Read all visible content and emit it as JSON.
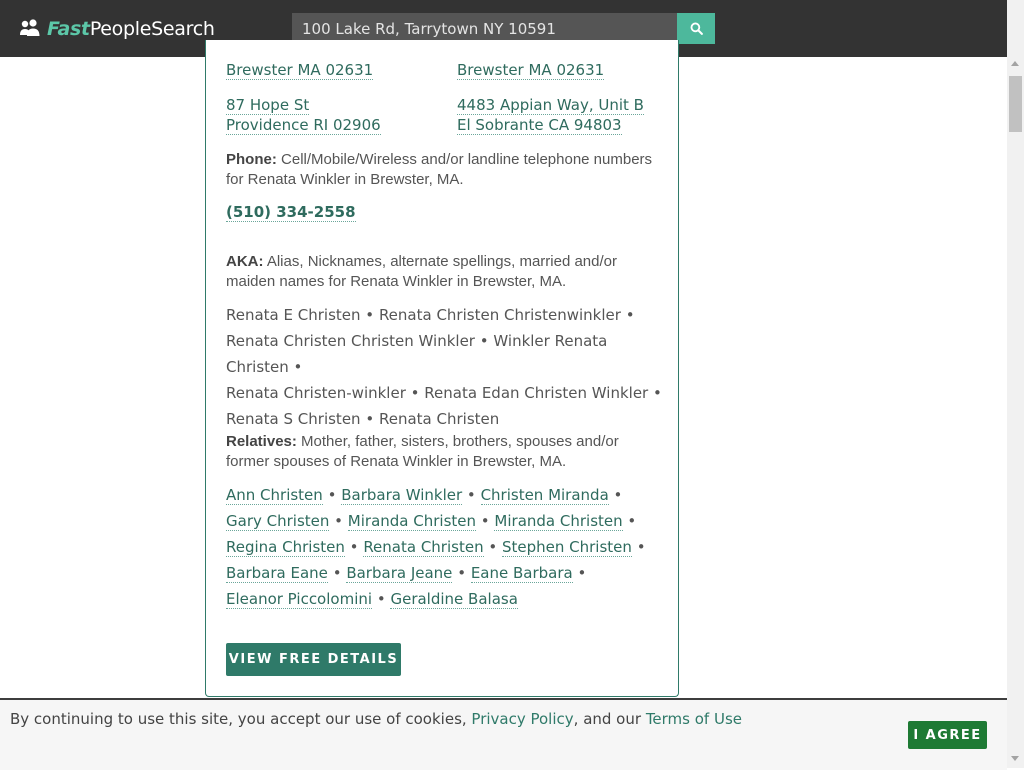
{
  "header": {
    "logo_fast": "Fast",
    "logo_rest": "PeopleSearch",
    "search_value": "100 Lake Rd, Tarrytown NY 10591"
  },
  "addresses": {
    "col1": [
      {
        "line2": "Brewster MA 02631"
      },
      {
        "line1": "87 Hope St",
        "line2": "Providence RI 02906"
      }
    ],
    "col2": [
      {
        "line2": "Brewster MA 02631"
      },
      {
        "line1": "4483 Appian Way, Unit B",
        "line2": "El Sobrante CA 94803"
      }
    ]
  },
  "phone_section": {
    "label": "Phone:",
    "description": "Cell/Mobile/Wireless and/or landline telephone numbers for Renata Winkler in Brewster, MA.",
    "number": "(510) 334-2558"
  },
  "aka_section": {
    "label": "AKA:",
    "description": "Alias, Nicknames, alternate spellings, married and/or maiden names for Renata Winkler in Brewster, MA.",
    "names": [
      "Renata E Christen",
      "Renata Christen Christenwinkler",
      "Renata Christen Christen Winkler",
      "Winkler Renata Christen",
      "Renata Christen-winkler",
      "Renata Edan Christen Winkler",
      "Renata S Christen",
      "Renata Christen"
    ]
  },
  "relatives_section": {
    "label": "Relatives:",
    "description": "Mother, father, sisters, brothers, spouses and/or former spouses of Renata Winkler in Brewster, MA.",
    "names": [
      "Ann Christen",
      "Barbara Winkler",
      "Christen Miranda",
      "Gary Christen",
      "Miranda Christen",
      "Miranda Christen",
      "Regina Christen",
      "Renata Christen",
      "Stephen Christen",
      "Barbara Eane",
      "Barbara Jeane",
      "Eane Barbara",
      "Eleanor Piccolomini",
      "Geraldine Balasa"
    ]
  },
  "details_button": "VIEW FREE DETAILS",
  "cookie": {
    "text_before": "By continuing to use this site, you accept our use of cookies, ",
    "privacy": "Privacy Policy",
    "text_mid": ", and our ",
    "terms": "Terms of Use",
    "agree": "I AGREE"
  },
  "colors": {
    "accent": "#2f7a69",
    "search_btn": "#4db89c",
    "agree_btn": "#1e7a34"
  }
}
